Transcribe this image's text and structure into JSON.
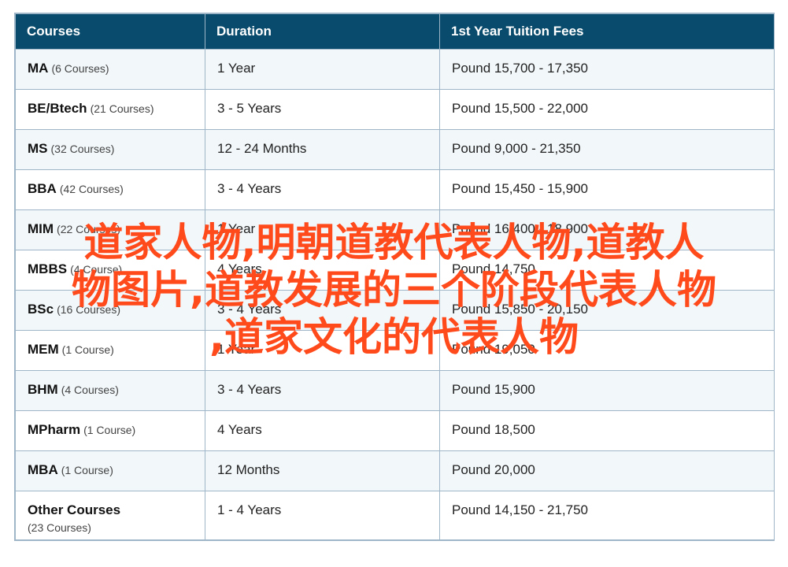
{
  "headers": [
    "Courses",
    "Duration",
    "1st Year Tuition Fees"
  ],
  "rows": [
    {
      "course": "MA",
      "count": "(6 Courses)",
      "duration": "1 Year",
      "fees": "Pound 15,700 - 17,350"
    },
    {
      "course": "BE/Btech",
      "count": "(21 Courses)",
      "duration": "3 - 5 Years",
      "fees": "Pound 15,500 - 22,000"
    },
    {
      "course": "MS",
      "count": "(32 Courses)",
      "duration": "12 - 24 Months",
      "fees": "Pound 9,000 - 21,350"
    },
    {
      "course": "BBA",
      "count": "(42 Courses)",
      "duration": "3 - 4 Years",
      "fees": "Pound 15,450 - 15,900"
    },
    {
      "course": "MIM",
      "count": "(22 Courses)",
      "duration": "1 Year",
      "fees": "Pound 16,400 - 18,900"
    },
    {
      "course": "MBBS",
      "count": "(4 Course)",
      "duration": "4 Years",
      "fees": "Pound 14,750"
    },
    {
      "course": "BSc",
      "count": "(16 Courses)",
      "duration": "3 - 4 Years",
      "fees": "Pound 15,850 - 20,150"
    },
    {
      "course": "MEM",
      "count": "(1 Course)",
      "duration": "1 Year",
      "fees": "Pound 19,050"
    },
    {
      "course": "BHM",
      "count": "(4 Courses)",
      "duration": "3 - 4 Years",
      "fees": "Pound 15,900"
    },
    {
      "course": "MPharm",
      "count": "(1 Course)",
      "duration": "4 Years",
      "fees": "Pound 18,500"
    },
    {
      "course": "MBA",
      "count": "(1 Course)",
      "duration": "12 Months",
      "fees": "Pound 20,000"
    },
    {
      "course": "Other Courses",
      "count": "(23 Courses)",
      "duration": "1 - 4 Years",
      "fees": "Pound 14,150 - 21,750"
    }
  ],
  "watermark": {
    "line1": "道家人物,明朝道教代表人物,道教人",
    "line2": "物图片,道教发展的三个阶段代表人物",
    "line3": ",道家文化的代表人物"
  },
  "colors": {
    "header_bg": "#094b6c",
    "row_alt": "#f2f7fa",
    "border": "#9fb6c8",
    "watermark": "#ff4a1c"
  }
}
